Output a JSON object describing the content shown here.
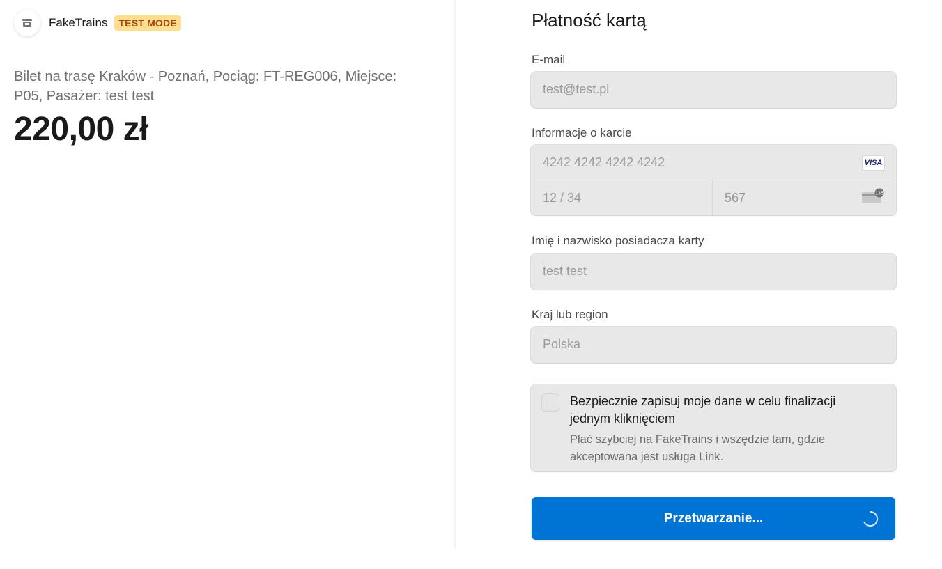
{
  "merchant": {
    "name": "FakeTrains",
    "badge": "TEST MODE",
    "logo_icon": "store-icon"
  },
  "order": {
    "description": "Bilet na trasę Kraków - Poznań, Pociąg: FT-REG006, Miejsce: P05, Pasażer: test test",
    "price": "220,00 zł"
  },
  "form": {
    "title": "Płatność kartą",
    "email": {
      "label": "E-mail",
      "value": "test@test.pl"
    },
    "card": {
      "label": "Informacje o karcie",
      "number": "4242 4242 4242 4242",
      "expiry": "12 / 34",
      "cvc": "567",
      "brand_icon": "visa-icon",
      "brand_text": "VISA",
      "cvc_icon": "card-cvc-icon",
      "cvc_icon_text": "135"
    },
    "cardholder": {
      "label": "Imię i nazwisko posiadacza karty",
      "value": "test test"
    },
    "country": {
      "label": "Kraj lub region",
      "value": "Polska"
    },
    "save_info": {
      "checked": false,
      "title": "Bezpiecznie zapisuj moje dane w celu finalizacji jednym kliknięciem",
      "subtitle": "Płać szybciej na FakeTrains i wszędzie tam, gdzie akceptowana jest usługa Link."
    },
    "submit": {
      "label": "Przetwarzanie...",
      "state": "processing"
    }
  },
  "colors": {
    "accent": "#0074d4",
    "badge_bg": "#ffde92",
    "badge_text": "#a24b07",
    "field_bg": "#e8e8e8"
  }
}
